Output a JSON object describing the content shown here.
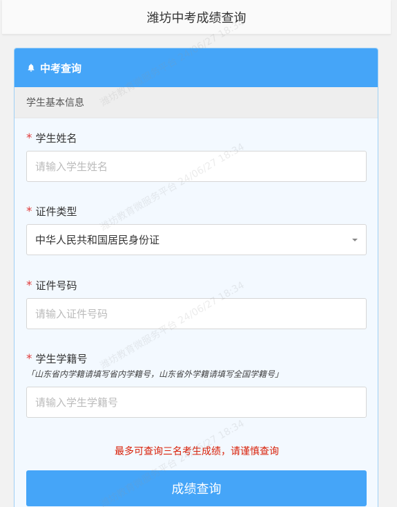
{
  "header": {
    "title": "潍坊中考成绩查询"
  },
  "card": {
    "title": "中考查询",
    "section": "学生基本信息",
    "fields": [
      {
        "label": "学生姓名",
        "placeholder": "请输入学生姓名"
      },
      {
        "label": "证件类型",
        "value": "中华人民共和国居民身份证"
      },
      {
        "label": "证件号码",
        "placeholder": "请输入证件号码"
      },
      {
        "label": "学生学籍号",
        "hint": "「山东省内学籍请填写省内学籍号，山东省外学籍请填写全国学籍号」",
        "placeholder": "请输入学生学籍号"
      }
    ],
    "warning": "最多可查询三名考生成绩，请谨慎查询",
    "submit": "成绩查询",
    "required_mark": "*"
  },
  "watermark": {
    "text": "潍坊教育微服务平台 24/06/27 18:34"
  },
  "colors": {
    "primary": "#45a5f8",
    "warning": "#d81e06",
    "required": "#e03c3c"
  }
}
